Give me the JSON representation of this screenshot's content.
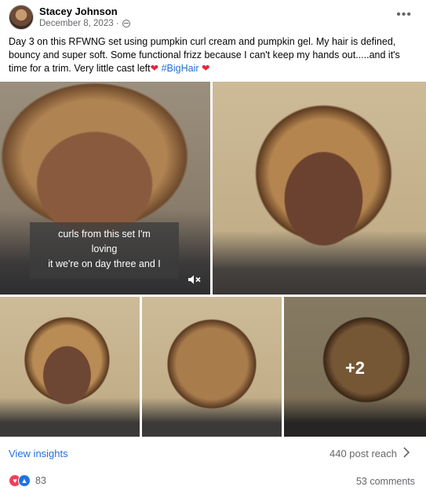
{
  "post": {
    "author": "Stacey Johnson",
    "date": "December 8, 2023 ·",
    "text_main": "Day 3 on this RFWNG set using pumpkin curl cream and pumpkin gel.  My hair is defined, bouncy and super soft. Some functional frizz because I can't keep my hands out.....and it's time for a trim.  Very little cast left",
    "hashtag": "#BigHair"
  },
  "media": {
    "caption_lines": [
      "curls from this set I'm",
      "loving",
      "it we're on day three and I"
    ],
    "more_count": "+2"
  },
  "footer": {
    "view_insights": "View insights",
    "post_reach": "440 post reach",
    "reaction_count": "83",
    "comments": "53 comments"
  },
  "colors": {
    "link_blue": "#216fdb",
    "heart_red": "#e8243b",
    "secondary_text": "#65676b"
  },
  "icons": [
    "avatar",
    "globe-icon",
    "more-options-icon",
    "heart-emoji-icon",
    "mute-icon",
    "chevron-right-icon",
    "love-reaction-icon",
    "like-reaction-icon"
  ]
}
